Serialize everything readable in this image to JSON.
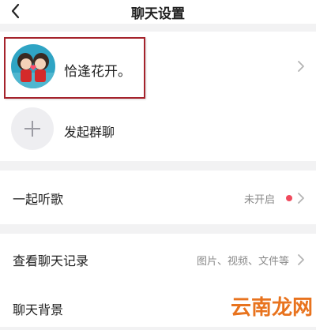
{
  "header": {
    "title": "聊天设置",
    "back_icon": "back-arrow-icon"
  },
  "profile": {
    "name": "恰逢花开。",
    "avatar": "couple-avatar",
    "highlight_color": "#a5232c"
  },
  "group_chat": {
    "label": "发起群聊",
    "icon": "plus-icon"
  },
  "listen_together": {
    "label": "一起听歌",
    "status": "未开启",
    "dot_color": "#f04a5d"
  },
  "chat_history": {
    "label": "查看聊天记录",
    "hint": "图片、视频、文件等"
  },
  "chat_background": {
    "label": "聊天背景"
  },
  "watermark": {
    "text": "云南龙网",
    "color": "#e8731e"
  }
}
